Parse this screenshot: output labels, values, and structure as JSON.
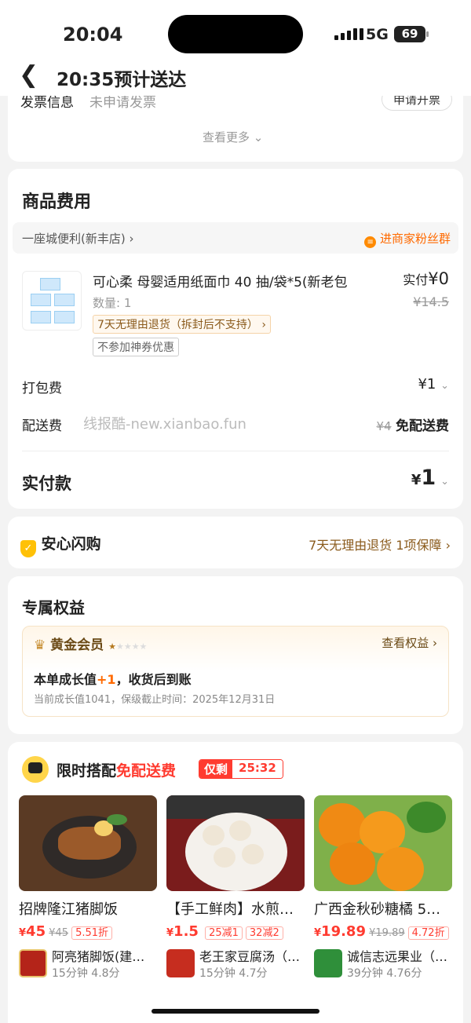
{
  "status_bar": {
    "time": "20:04",
    "network": "5G",
    "battery": "69"
  },
  "nav": {
    "title": "20:35预计送达"
  },
  "invoice": {
    "label": "发票信息",
    "value": "未申请发票",
    "button": "申请开票",
    "more": "查看更多"
  },
  "goods": {
    "title": "商品费用",
    "shop_name": "一座城便利(新丰店)",
    "fans_group": "进商家粉丝群",
    "item": {
      "name": "可心柔 母婴适用纸面巾 40 抽/袋*5(新老包",
      "qty": "数量: 1",
      "paid_label": "实付",
      "paid": "¥0",
      "orig": "¥14.5",
      "tag_return": "7天无理由退货（拆封后不支持）",
      "tag_coupon": "不参加神券优惠"
    },
    "packing_label": "打包费",
    "packing_value": "¥1",
    "delivery_label": "配送费",
    "watermark": "线报酷-new.xianbao.fun",
    "delivery_orig": "¥4",
    "delivery_value": "免配送费",
    "total_label": "实付款",
    "total_currency": "¥",
    "total_value": "1"
  },
  "assurance": {
    "title": "安心闪购",
    "desc": "7天无理由退货 1项保障"
  },
  "benefits": {
    "title": "专属权益",
    "member": "黄金会员",
    "stars": "★★★★★",
    "view": "查看权益",
    "growth_prefix": "本单成长值",
    "growth_value": "+1",
    "growth_suffix": "，收货后到账",
    "current": "当前成长值1041，保级截止时间：2025年12月31日"
  },
  "promo": {
    "title_a": "限时搭配",
    "title_b": "免配送费",
    "only_left": "仅剩",
    "countdown": "25:32",
    "products": [
      {
        "name": "招牌隆江猪脚饭",
        "price_sym": "¥",
        "price": "45",
        "orig": "¥45",
        "discounts": [
          "5.51折"
        ],
        "shop": "阿亮猪脚饭(建…",
        "eta": "15分钟",
        "rating": "4.8分"
      },
      {
        "name": "【手工鲜肉】水煎…",
        "price_sym": "¥",
        "price": "1.5",
        "orig": "",
        "discounts": [
          "25减1",
          "32减2"
        ],
        "shop": "老王家豆腐汤（…",
        "eta": "15分钟",
        "rating": "4.7分"
      },
      {
        "name": "广西金秋砂糖橘 5…",
        "price_sym": "¥",
        "price": "19.89",
        "orig": "¥19.89",
        "discounts": [
          "4.72折"
        ],
        "shop": "诚信志远果业（…",
        "eta": "39分钟",
        "rating": "4.76分"
      }
    ]
  },
  "colors": {
    "accent": "#ff6a00",
    "red": "#ff3b30",
    "gold": "#b5791e"
  }
}
